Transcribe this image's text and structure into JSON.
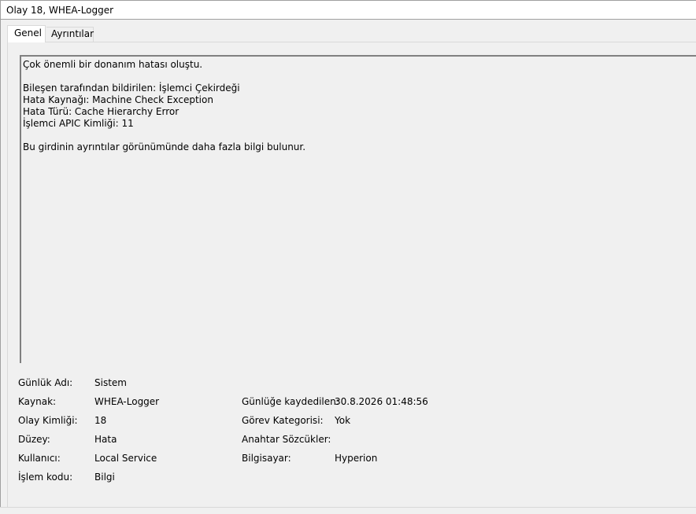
{
  "window": {
    "title": "Olay 18, WHEA-Logger"
  },
  "tabs": [
    {
      "label": "Genel",
      "active": true
    },
    {
      "label": "Ayrıntılar",
      "active": false
    }
  ],
  "description": {
    "lines": [
      "Çok önemli bir donanım hatası oluştu.",
      "",
      "Bileşen tarafından bildirilen: İşlemci Çekirdeği",
      "Hata Kaynağı: Machine Check Exception",
      "Hata Türü: Cache Hierarchy Error",
      "İşlemci APIC Kimliği: 11",
      "",
      "Bu girdinin ayrıntılar görünümünde daha fazla bilgi bulunur."
    ]
  },
  "properties": {
    "log_name": {
      "label": "Günlük Adı:",
      "value": "Sistem"
    },
    "source": {
      "label": "Kaynak:",
      "value": "WHEA-Logger"
    },
    "logged": {
      "label": "Günlüğe kaydedilen:",
      "value": "30.8.2026 01:48:56"
    },
    "event_id": {
      "label": "Olay Kimliği:",
      "value": "18"
    },
    "task_category": {
      "label": "Görev Kategorisi:",
      "value": "Yok"
    },
    "level": {
      "label": "Düzey:",
      "value": "Hata"
    },
    "keywords": {
      "label": "Anahtar Sözcükler:",
      "value": ""
    },
    "user": {
      "label": "Kullanıcı:",
      "value": "Local Service"
    },
    "computer": {
      "label": "Bilgisayar:",
      "value": "Hyperion"
    },
    "opcode": {
      "label": "İşlem kodu:",
      "value": "Bilgi"
    }
  }
}
